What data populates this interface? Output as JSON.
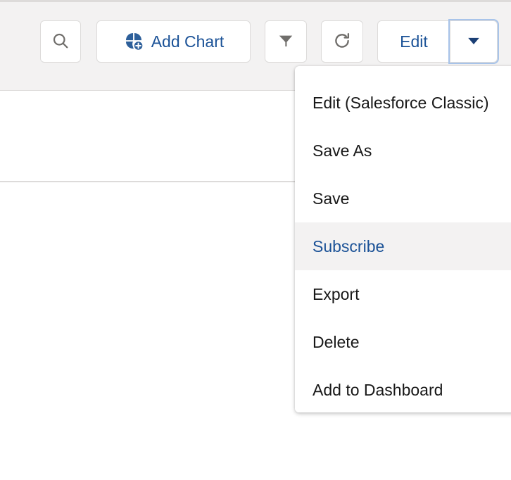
{
  "toolbar": {
    "buttons": [
      {
        "name": "search",
        "icon": "search-icon",
        "label": ""
      },
      {
        "name": "add-chart",
        "icon": "pie-chart-add-icon",
        "label": "Add Chart"
      },
      {
        "name": "filter",
        "icon": "filter-funnel-icon",
        "label": ""
      },
      {
        "name": "refresh",
        "icon": "refresh-icon",
        "label": ""
      },
      {
        "name": "edit",
        "icon": "",
        "label": "Edit"
      },
      {
        "name": "edit-dropdown",
        "icon": "chevron-down-icon",
        "label": ""
      }
    ],
    "search_label": "Search",
    "add_chart_label": "Add Chart",
    "filter_label": "Filter",
    "refresh_label": "Refresh",
    "edit_label": "Edit",
    "dropdown_label": "Show more actions"
  },
  "dropdown_menu": {
    "open": true,
    "highlighted_index": 3,
    "items": [
      {
        "label": "Edit (Salesforce Classic)",
        "highlighted": false
      },
      {
        "label": "Save As",
        "highlighted": false
      },
      {
        "label": "Save",
        "highlighted": false
      },
      {
        "label": "Subscribe",
        "highlighted": true
      },
      {
        "label": "Export",
        "highlighted": false
      },
      {
        "label": "Delete",
        "highlighted": false
      },
      {
        "label": "Add to Dashboard",
        "highlighted": false
      }
    ]
  },
  "colors": {
    "brand_blue": "#1b5297",
    "icon_gray": "#706e6b",
    "toolbar_bg": "#f3f2f2",
    "border": "#dddbda",
    "highlight_bg": "#f3f2f2",
    "focus_ring": "#a8c4ea",
    "text": "#181818"
  }
}
